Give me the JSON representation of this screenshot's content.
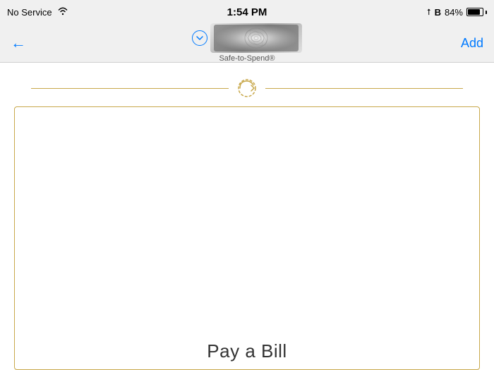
{
  "statusBar": {
    "noService": "No Service",
    "time": "1:54 PM",
    "batteryPercent": "84%"
  },
  "navBar": {
    "backLabel": "←",
    "accountLabel": "Safe-to-Spend®",
    "addLabel": "Add"
  },
  "main": {
    "payBillLabel": "Pay a Bill"
  },
  "icons": {
    "wifi": "📶",
    "location": "▲",
    "bluetooth": "B"
  }
}
